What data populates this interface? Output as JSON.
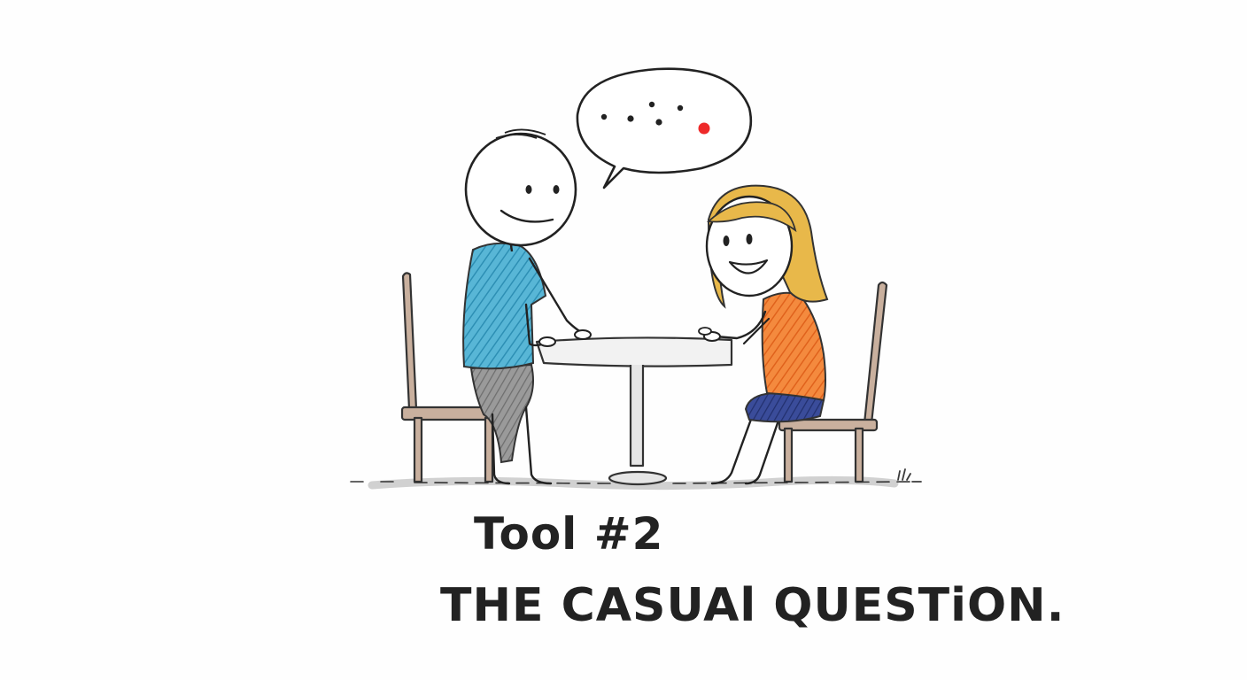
{
  "caption": {
    "line1": "Tool #2",
    "line2": "THE CASUAl QUESTiON."
  },
  "colors": {
    "ink": "#222222",
    "man_shirt": "#3aa6c9",
    "man_pants": "#8c8c8c",
    "woman_hair": "#e8b84a",
    "woman_top": "#f07b2e",
    "woman_skirt": "#2d3f8a",
    "chair_wood": "#c9b09e",
    "bubble_red_dot": "#ee2a2a",
    "ground_shadow": "#bdbdbd"
  },
  "icons": {
    "speech_bubble": "speech-bubble-icon",
    "grass_tuft": "grass-tuft-icon"
  }
}
